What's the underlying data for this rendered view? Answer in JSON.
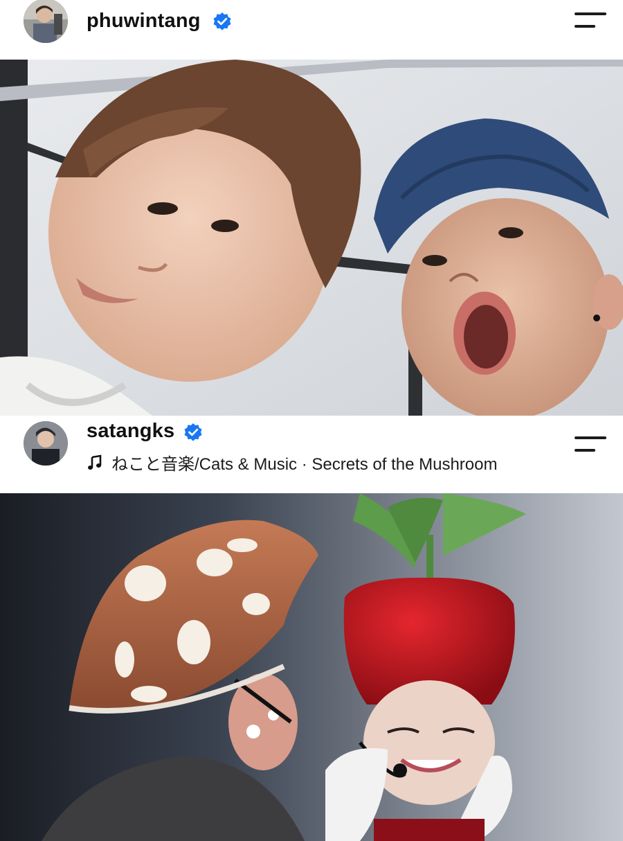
{
  "posts": [
    {
      "username": "phuwintang",
      "verified": true,
      "menu_icon": "hamburger-menu-icon",
      "photo_description_icon": "selfie-photo"
    },
    {
      "username": "satangks",
      "verified": true,
      "music": "ねこと音楽/Cats & Music · Secrets of the Mushroom",
      "music_icon": "music-note-icon",
      "menu_icon": "hamburger-menu-icon",
      "photo_description_icon": "costume-performance-photo"
    }
  ],
  "colors": {
    "verified_blue": "#1877f2",
    "text": "#111111"
  }
}
